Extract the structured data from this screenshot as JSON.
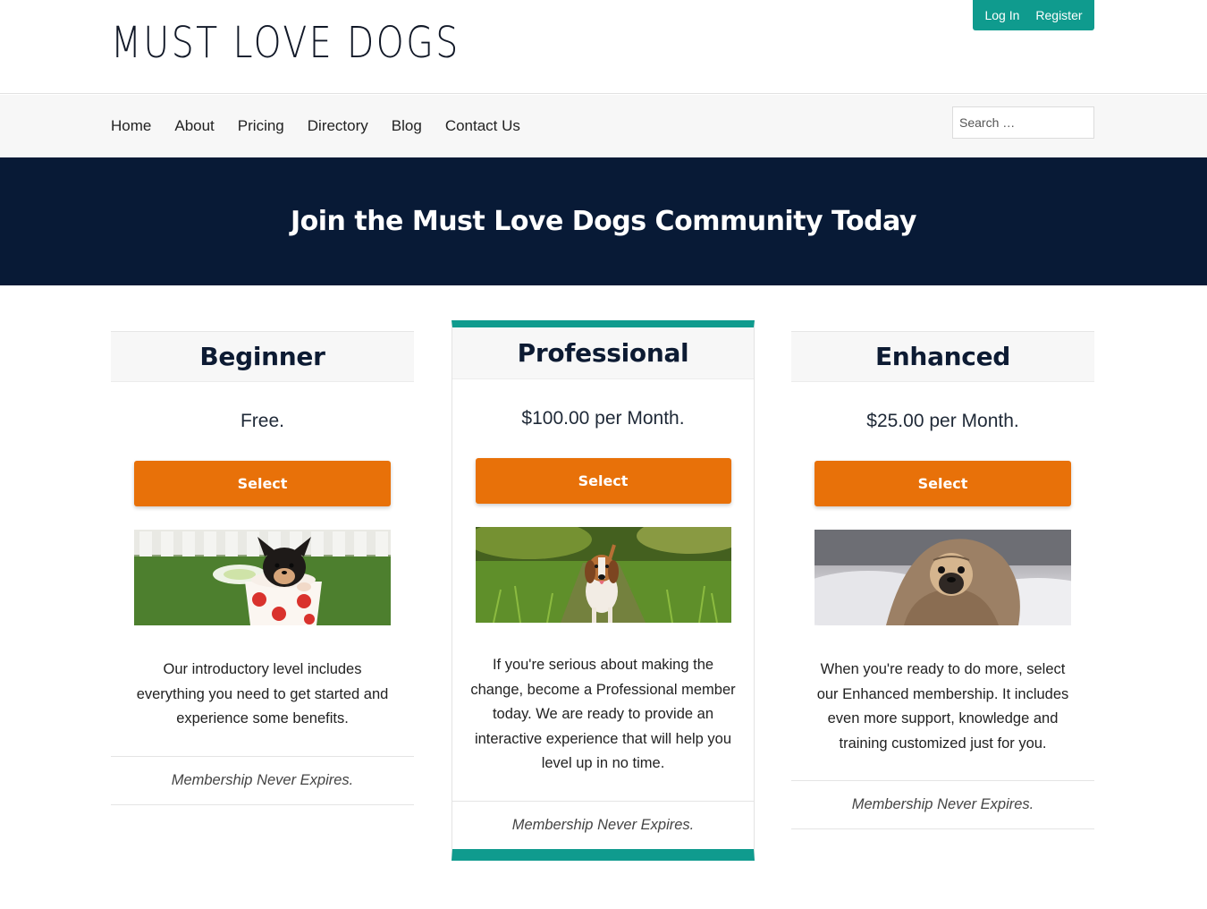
{
  "header": {
    "logo_text": "MUST LOVE DOGS",
    "login_label": "Log In",
    "register_label": "Register"
  },
  "nav": {
    "items": [
      {
        "label": "Home"
      },
      {
        "label": "About"
      },
      {
        "label": "Pricing"
      },
      {
        "label": "Directory"
      },
      {
        "label": "Blog"
      },
      {
        "label": "Contact Us"
      }
    ],
    "search_placeholder": "Search …"
  },
  "hero": {
    "title": "Join the Must Love Dogs Community Today"
  },
  "plans": [
    {
      "name": "Beginner",
      "price": "Free.",
      "select_label": "Select",
      "description": "Our introductory level includes everything you need to get started and experience some benefits.",
      "footer": "Membership Never Expires."
    },
    {
      "name": "Professional",
      "price": "$100.00 per Month.",
      "select_label": "Select",
      "description": "If you're serious about making the change, become a Professional member today. We are ready to provide an interactive experience that will help you level up in no time.",
      "footer": "Membership Never Expires."
    },
    {
      "name": "Enhanced",
      "price": "$25.00 per Month.",
      "select_label": "Select",
      "description": "When you're ready to do more, select our Enhanced membership. It includes even more support, knowledge and training customized just for you.",
      "footer": "Membership Never Expires."
    }
  ],
  "colors": {
    "accent_teal": "#0f9b8e",
    "button_orange": "#e87109",
    "hero_navy": "#081a36"
  }
}
